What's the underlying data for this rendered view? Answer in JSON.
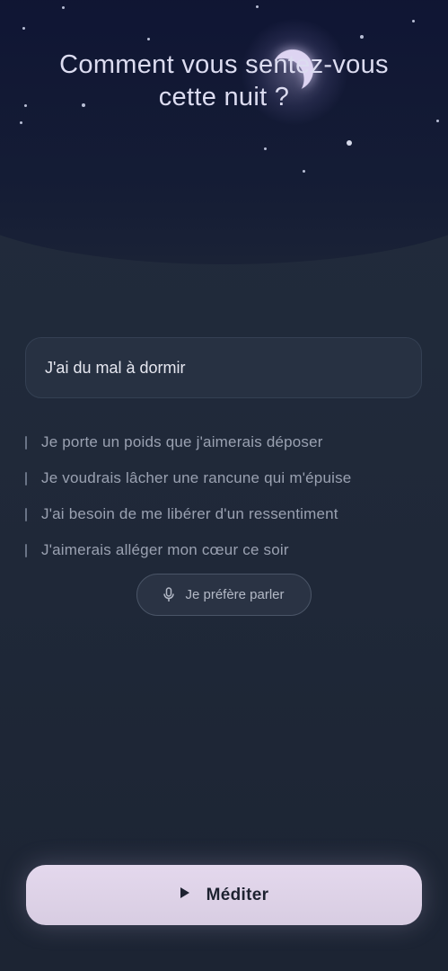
{
  "header": {
    "title_line1": "Comment vous sentez-vous",
    "title_line2": "cette nuit ?"
  },
  "input": {
    "value": "J'ai du mal à dormir"
  },
  "suggestions": [
    {
      "label": "Je porte un poids que j'aimerais déposer"
    },
    {
      "label": "Je voudrais lâcher une rancune qui m'épuise"
    },
    {
      "label": "J'ai besoin de me libérer d'un ressentiment"
    },
    {
      "label": "J'aimerais alléger mon cœur ce soir"
    }
  ],
  "speak_button": {
    "label": "Je préfère parler",
    "icon": "microphone-icon"
  },
  "meditate_button": {
    "label": "Méditer",
    "icon": "play-icon"
  },
  "colors": {
    "sky": "#0b1028",
    "background": "#1e2737",
    "accent": "#e4d8ed",
    "moon": "#ddd4f2"
  }
}
